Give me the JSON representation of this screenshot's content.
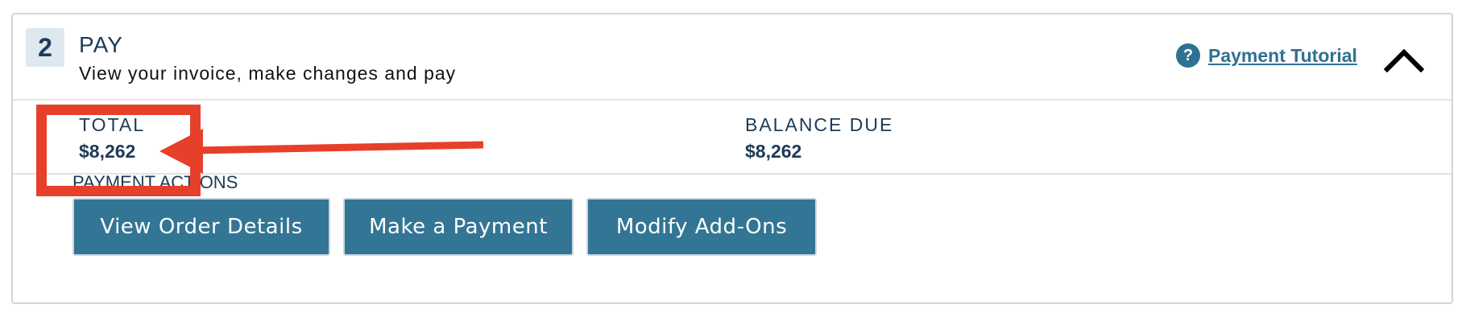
{
  "step": {
    "number": "2",
    "title": "PAY",
    "subtitle": "View your invoice, make changes and pay"
  },
  "header": {
    "help_icon_glyph": "?",
    "tutorial_label": "Payment Tutorial",
    "collapse_icon": "chevron-up-icon"
  },
  "summary": {
    "total_label": "TOTAL",
    "total_value": "$8,262",
    "balance_label": "BALANCE DUE",
    "balance_value": "$8,262"
  },
  "actions": {
    "label": "PAYMENT ACTIONS",
    "buttons": [
      "View Order Details",
      "Make a Payment",
      "Modify Add-Ons"
    ]
  },
  "colors": {
    "accent": "#337594",
    "heading": "#1e3a55",
    "annotation": "#e6402b",
    "badge_bg": "#dde8ef"
  }
}
